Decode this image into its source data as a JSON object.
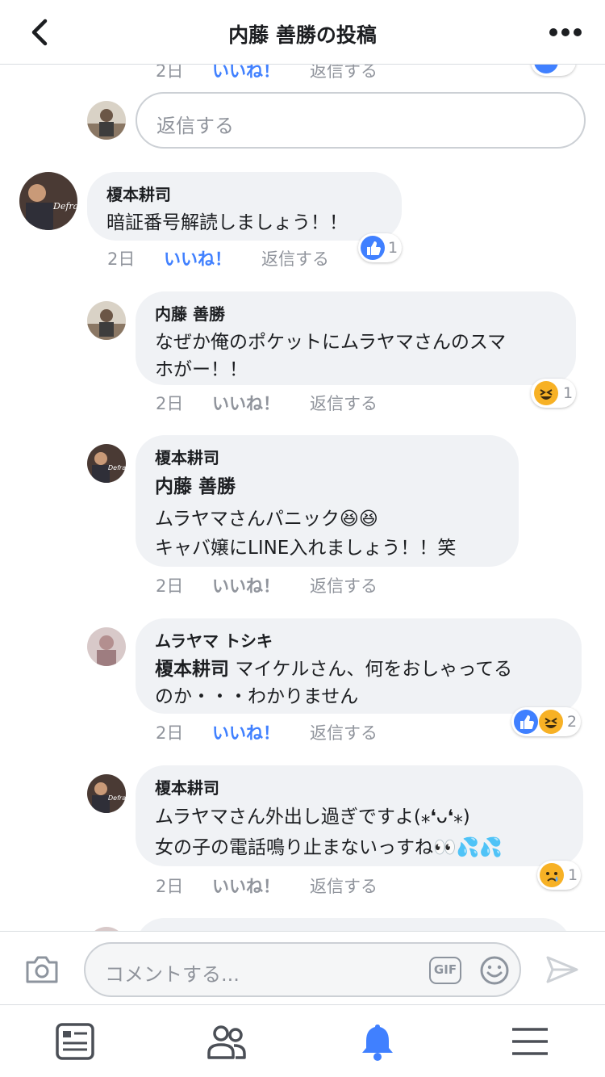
{
  "header": {
    "title": "内藤 善勝の投稿"
  },
  "top_meta": {
    "date": "2日",
    "like": "いいね！",
    "reply": "返信する"
  },
  "reply_input": {
    "placeholder": "返信する"
  },
  "comments": [
    {
      "name": "榎本耕司",
      "lines": [
        "暗証番号解読しましょう！！"
      ],
      "date": "2日",
      "like": "いいね！",
      "reply": "返信する",
      "reaction_count": "1"
    },
    {
      "name": "内藤 善勝",
      "lines": [
        "なぜか俺のポケットにムラヤマさんのスマ",
        "ホがー！！"
      ],
      "date": "2日",
      "like": "いいね！",
      "reply": "返信する",
      "reaction_count": "1"
    },
    {
      "name": "榎本耕司",
      "mention": "内藤 善勝",
      "lines": [
        "ムラヤマさんパニック😆😆",
        "キャバ嬢にLINE入れましょう！！笑"
      ],
      "date": "2日",
      "like": "いいね！",
      "reply": "返信する"
    },
    {
      "name": "ムラヤマ トシキ",
      "mention": "榎本耕司",
      "lines": [
        "マイケルさん、何をおしゃってる",
        "のか・・・わかりません"
      ],
      "date": "2日",
      "like": "いいね！",
      "reply": "返信する",
      "reaction_count": "2"
    },
    {
      "name": "榎本耕司",
      "lines": [
        "ムラヤマさん外出し過ぎですよ(⁎❛ᴗ❛⁎)",
        "女の子の電話鳴り止まないっすね👀💦💦"
      ],
      "date": "2日",
      "like": "いいね！",
      "reply": "返信する",
      "reaction_count": "1"
    }
  ],
  "comment_bar": {
    "placeholder": "コメントする...",
    "gif_label": "GIF"
  },
  "colors": {
    "accent": "#4080ff",
    "bubble": "#f0f2f5",
    "muted": "#90949c",
    "text": "#1c1e21"
  }
}
